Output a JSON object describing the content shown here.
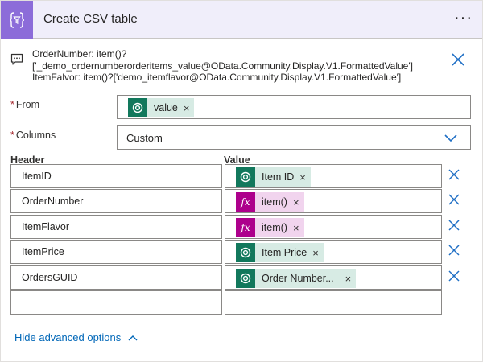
{
  "header": {
    "title": "Create CSV table",
    "icon": "table-filter-icon",
    "menu_label": "···",
    "accent_color": "#8c6cd9",
    "background_color": "#f0eefa"
  },
  "comment": {
    "lines": [
      "OrderNumber: item()?",
      "['_demo_ordernumberorderitems_value@OData.Community.Display.V1.FormattedValue']",
      "ItemFalvor: item()?['demo_itemflavor@OData.Community.Display.V1.FormattedValue']"
    ]
  },
  "from": {
    "label": "From",
    "required_mark": "*",
    "token": {
      "label": "value",
      "type": "dataverse",
      "remove": "×"
    }
  },
  "columns": {
    "label": "Columns",
    "required_mark": "*",
    "selected": "Custom"
  },
  "table": {
    "header_col": "Header",
    "value_col": "Value",
    "rows": [
      {
        "header": "ItemID",
        "value": "Item ID",
        "type": "dataverse",
        "remove": "×"
      },
      {
        "header": "OrderNumber",
        "value": "item()",
        "type": "expression",
        "remove": "×"
      },
      {
        "header": "ItemFlavor",
        "value": "item()",
        "type": "expression",
        "remove": "×"
      },
      {
        "header": "ItemPrice",
        "value": "Item Price",
        "type": "dataverse",
        "remove": "×"
      },
      {
        "header": "OrdersGUID",
        "value": "Order Number...",
        "type": "dataverse",
        "remove": "×"
      },
      {
        "header": "",
        "value": ""
      }
    ]
  },
  "footer": {
    "advanced_label": "Hide advanced options"
  },
  "colors": {
    "link": "#0067b8",
    "delete_x": "#1f6fc5",
    "dataverse_token_bg": "#d7ebe4",
    "dataverse_icon_bg": "#12785c",
    "expression_token_bg": "#f1d4ee",
    "expression_icon_bg": "#ad008c",
    "required": "#a4262c"
  }
}
